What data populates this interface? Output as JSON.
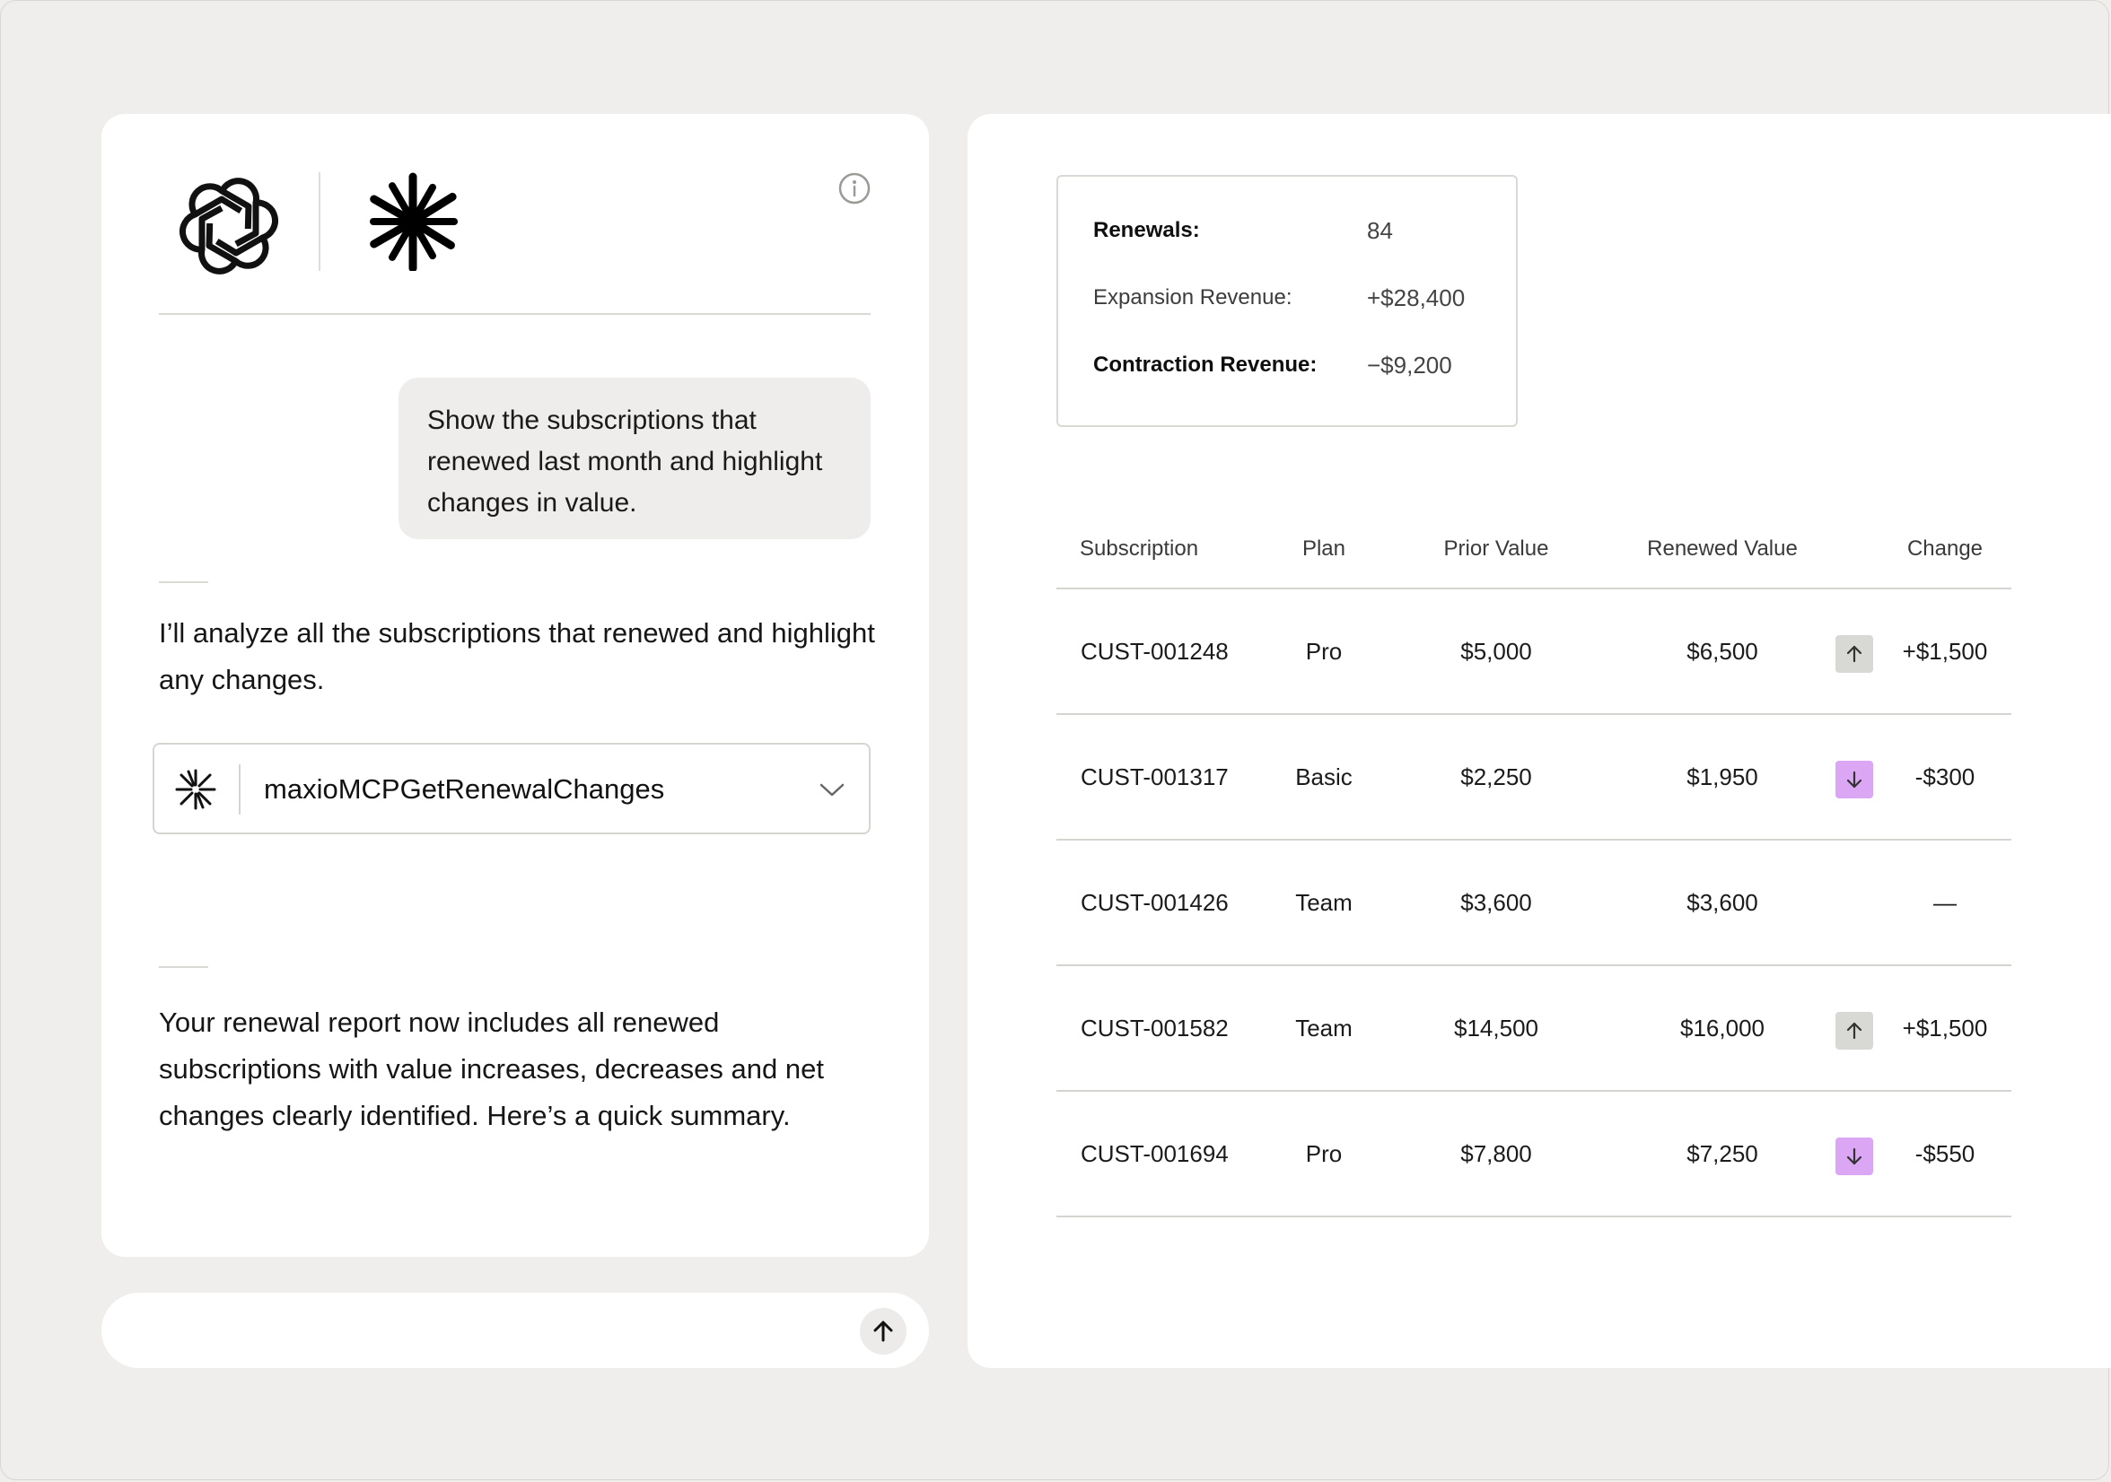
{
  "chat": {
    "user_message": "Show the subscriptions that renewed last month and highlight changes in value.",
    "assistant_intro": "I’ll analyze all the subscriptions that renewed and highlight any changes.",
    "tool_call": {
      "name": "maxioMCPGetRenewalChanges",
      "icon": "asterisk-spark-icon"
    },
    "assistant_summary": "Your renewal report now includes all renewed subscriptions with value increases, decreases and net changes clearly identified. Here’s a quick summary.",
    "input": {
      "placeholder": "",
      "send_icon": "arrow-up-icon"
    },
    "header_icons": [
      "openai-logo-icon",
      "claude-logo-icon",
      "info-icon"
    ]
  },
  "summary": {
    "renewals_label": "Renewals:",
    "renewals_value": "84",
    "expansion_label": "Expansion Revenue:",
    "expansion_value": "+$28,400",
    "contraction_label": "Contraction Revenue:",
    "contraction_value": "−$9,200"
  },
  "table": {
    "headers": [
      "Subscription",
      "Plan",
      "Prior Value",
      "Renewed Value",
      "Change"
    ],
    "rows": [
      {
        "subscription": "CUST-001248",
        "plan": "Pro",
        "prior": "$5,000",
        "renewed": "$6,500",
        "change": "+$1,500",
        "direction": "up"
      },
      {
        "subscription": "CUST-001317",
        "plan": "Basic",
        "prior": "$2,250",
        "renewed": "$1,950",
        "change": "-$300",
        "direction": "down"
      },
      {
        "subscription": "CUST-001426",
        "plan": "Team",
        "prior": "$3,600",
        "renewed": "$3,600",
        "change": "—",
        "direction": "none"
      },
      {
        "subscription": "CUST-001582",
        "plan": "Team",
        "prior": "$14,500",
        "renewed": "$16,000",
        "change": "+$1,500",
        "direction": "up"
      },
      {
        "subscription": "CUST-001694",
        "plan": "Pro",
        "prior": "$7,800",
        "renewed": "$7,250",
        "change": "-$550",
        "direction": "down"
      }
    ]
  },
  "colors": {
    "background": "#efeeec",
    "panel": "#ffffff",
    "bubble": "#eeedeb",
    "badge_up": "#d8d8d5",
    "badge_down": "#dba6f4"
  }
}
